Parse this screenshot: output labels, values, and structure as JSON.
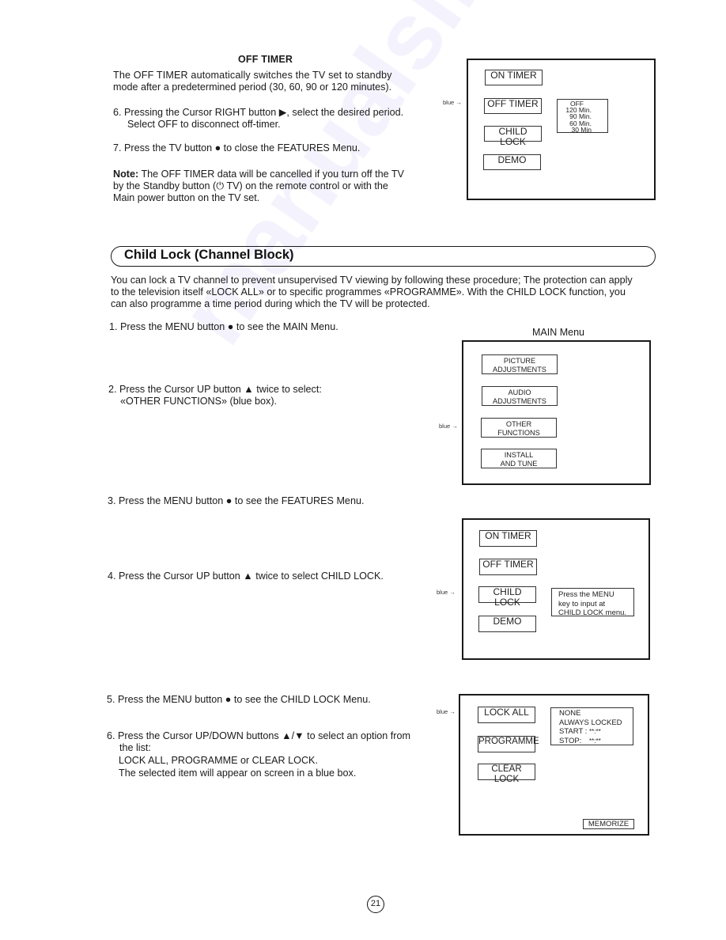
{
  "watermark": "manualslib",
  "off_timer": {
    "heading": "OFF TIMER",
    "intro_lines": [
      "The OFF TIMER automatically switches the TV set to standby",
      "mode after a predetermined period (30, 60, 90 or 120 minutes)."
    ],
    "step6_lines": [
      "6. Pressing the Cursor RIGHT button ▶, select the desired period.",
      "Select OFF to disconnect off-timer."
    ],
    "step7": "7. Press the TV button ● to close the FEATURES Menu.",
    "note_label": "Note:",
    "note_lines": [
      " The OFF TIMER data will be cancelled if you turn off the TV",
      "by the Standby button (⏻  TV) on the remote control or with the",
      "Main power button on the TV set."
    ],
    "menu": {
      "pointer_label": "blue →",
      "buttons": [
        "ON TIMER",
        "OFF TIMER",
        "CHILD LOCK",
        "DEMO"
      ],
      "options": [
        "OFF",
        "120  Min.",
        "90  Min.",
        "60  Min.",
        "30  Min"
      ]
    }
  },
  "child_lock": {
    "section_title": "Child Lock (Channel Block)",
    "intro_lines": [
      "You can lock a TV channel to prevent unsupervised TV viewing by following these procedure; The protection can apply",
      "to the television itself «LOCK ALL» or to specific programmes «PROGRAMME». With the CHILD LOCK function, you",
      "can also programme a time period during which the TV will be protected."
    ],
    "step1": "1. Press the MENU button ● to see the MAIN Menu.",
    "step2_lines": [
      "2. Press the Cursor UP button ▲ twice to select:",
      "«OTHER FUNCTIONS» (blue box)."
    ],
    "main_menu": {
      "caption": "MAIN Menu",
      "pointer_label": "blue →",
      "buttons": [
        {
          "line1": "PICTURE",
          "line2": "ADJUSTMENTS"
        },
        {
          "line1": "AUDIO",
          "line2": "ADJUSTMENTS"
        },
        {
          "line1": "OTHER",
          "line2": "FUNCTIONS"
        },
        {
          "line1": "INSTALL",
          "line2": "AND TUNE"
        }
      ]
    },
    "step3": "3. Press the MENU button ● to see the FEATURES Menu.",
    "step4": "4.  Press the Cursor UP button ▲ twice to select CHILD LOCK.",
    "features_menu": {
      "pointer_label": "blue →",
      "buttons": [
        "ON TIMER",
        "OFF TIMER",
        "CHILD LOCK",
        "DEMO"
      ],
      "info_lines": [
        "Press the MENU",
        "key to input at",
        "CHILD LOCK menu."
      ]
    },
    "step5": "5. Press the MENU button ● to see the CHILD LOCK Menu.",
    "step6_lines": [
      "6. Press the Cursor UP/DOWN buttons ▲/▼ to select an option from",
      "the list:",
      "LOCK ALL, PROGRAMME or CLEAR LOCK.",
      "The selected item will appear on screen in a blue box."
    ],
    "child_lock_menu": {
      "pointer_label": "blue →",
      "buttons": [
        "LOCK ALL",
        "PROGRAMME",
        "CLEAR LOCK"
      ],
      "options": [
        {
          "label": "NONE",
          "value": ""
        },
        {
          "label": "ALWAYS LOCKED",
          "value": ""
        },
        {
          "label": "START :",
          "value": "**:**"
        },
        {
          "label": "STOP:",
          "value": "**:**"
        }
      ],
      "memorize_label": "MEMORIZE"
    }
  },
  "page_number": "21"
}
